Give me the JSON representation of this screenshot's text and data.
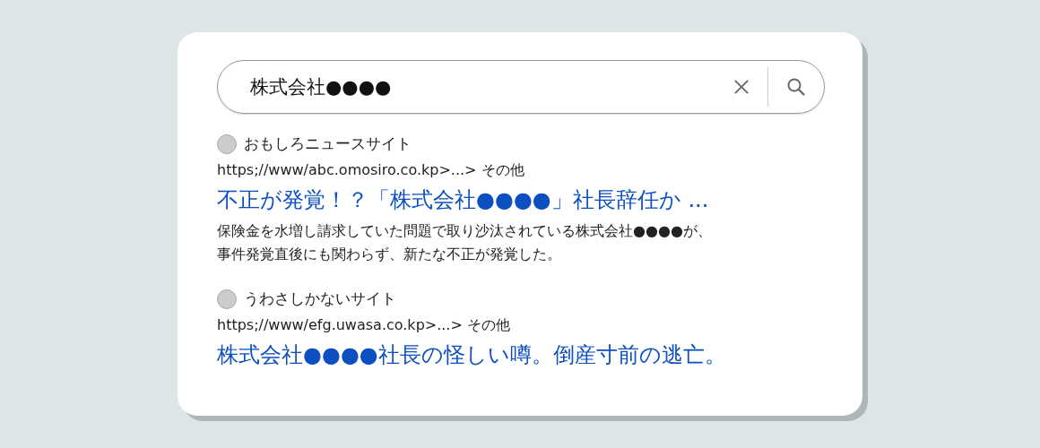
{
  "search": {
    "value": "株式会社●●●●"
  },
  "results": [
    {
      "site": "おもしろニュースサイト",
      "url": "https;//www/abc.omosiro.co.kp>...> その他",
      "title": "不正が発覚！？「株式会社●●●●」社長辞任か ...",
      "description": [
        "保険金を水増し請求していた問題で取り沙汰されている株式会社●●●●が、",
        "事件発覚直後にも関わらず、新たな不正が発覚した。"
      ]
    },
    {
      "site": "うわさしかないサイト",
      "url": "https;//www/efg.uwasa.co.kp>...> その他",
      "title": "株式会社●●●●社長の怪しい噂。倒産寸前の逃亡。"
    }
  ]
}
